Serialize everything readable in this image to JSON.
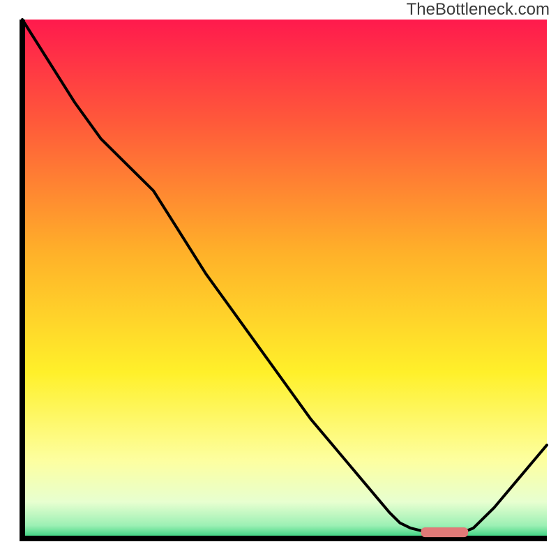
{
  "watermark": "TheBottleneck.com",
  "chart_data": {
    "type": "line",
    "title": "",
    "xlabel": "",
    "ylabel": "",
    "x": [
      0.0,
      0.05,
      0.1,
      0.15,
      0.2,
      0.25,
      0.3,
      0.35,
      0.4,
      0.45,
      0.5,
      0.55,
      0.6,
      0.65,
      0.7,
      0.72,
      0.74,
      0.76,
      0.78,
      0.8,
      0.82,
      0.84,
      0.86,
      0.9,
      0.95,
      1.0
    ],
    "values": [
      1.0,
      0.92,
      0.84,
      0.77,
      0.72,
      0.67,
      0.59,
      0.51,
      0.44,
      0.37,
      0.3,
      0.23,
      0.17,
      0.11,
      0.05,
      0.03,
      0.02,
      0.015,
      0.012,
      0.011,
      0.011,
      0.012,
      0.02,
      0.06,
      0.12,
      0.18
    ],
    "xlim": [
      0,
      1
    ],
    "ylim": [
      0,
      1
    ],
    "highlight_bar": {
      "x_start": 0.76,
      "x_end": 0.85,
      "y": 0.012
    },
    "gradient_stops": [
      {
        "offset": 0.0,
        "color": "#ff1a4d"
      },
      {
        "offset": 0.2,
        "color": "#ff5a3a"
      },
      {
        "offset": 0.45,
        "color": "#ffb129"
      },
      {
        "offset": 0.68,
        "color": "#fff02a"
      },
      {
        "offset": 0.85,
        "color": "#fdffa0"
      },
      {
        "offset": 0.93,
        "color": "#e7ffd0"
      },
      {
        "offset": 0.975,
        "color": "#9cf0b4"
      },
      {
        "offset": 1.0,
        "color": "#2ecf7a"
      }
    ]
  }
}
